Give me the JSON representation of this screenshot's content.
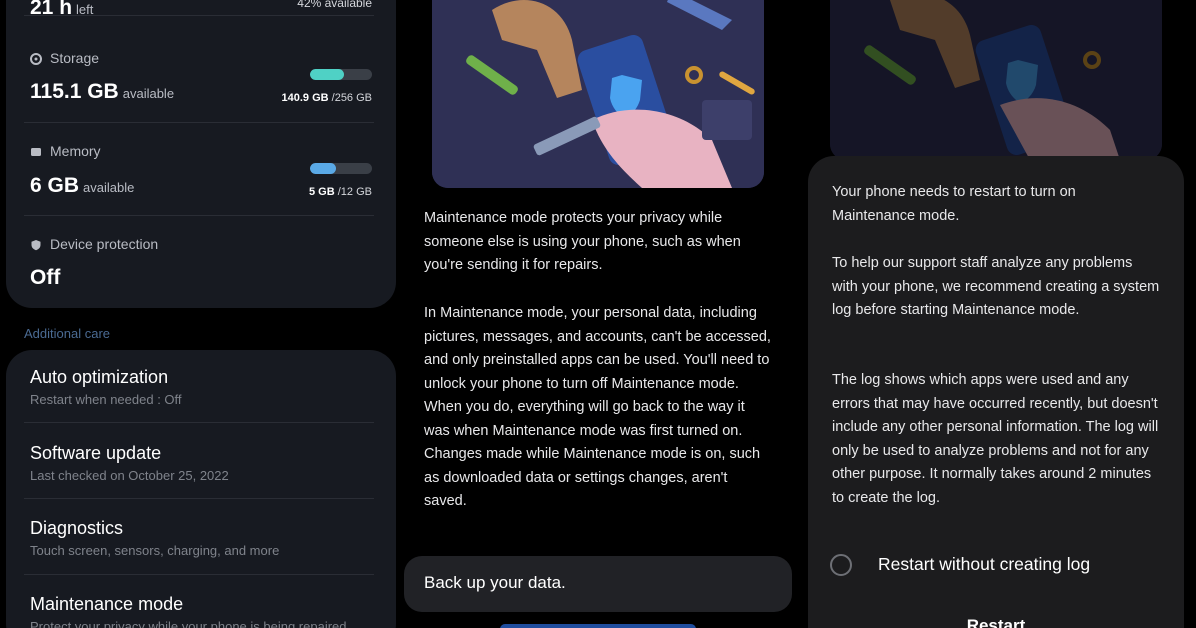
{
  "device_care": {
    "top_partial": {
      "value": "21 h",
      "unit": "left",
      "right": "42% available"
    },
    "storage": {
      "label": "Storage",
      "value": "115.1 GB",
      "unit": "available",
      "used": "140.9 GB",
      "total": "/256 GB",
      "fill_fraction": 0.55,
      "fill_color": "#4fd1c5"
    },
    "memory": {
      "label": "Memory",
      "value": "6 GB",
      "unit": "available",
      "used": "5 GB",
      "total": "/12 GB",
      "fill_fraction": 0.42,
      "fill_color": "#5aa9e6"
    },
    "protection": {
      "label": "Device protection",
      "value": "Off"
    },
    "additional_care": "Additional care",
    "menu": [
      {
        "title": "Auto optimization",
        "subtitle": "Restart when needed : Off"
      },
      {
        "title": "Software update",
        "subtitle": "Last checked on October 25, 2022"
      },
      {
        "title": "Diagnostics",
        "subtitle": "Touch screen, sensors, charging, and more"
      },
      {
        "title": "Maintenance mode",
        "subtitle": "Protect your privacy while your phone is being repaired"
      }
    ]
  },
  "maintenance_info": {
    "paragraph1": "Maintenance mode protects your privacy while someone else is using your phone, such as when you're sending it for repairs.",
    "paragraph2": "In Maintenance mode, your personal data, including pictures, messages, and accounts, can't be accessed, and only preinstalled apps can be used. You'll need to unlock your phone to turn off Maintenance mode. When you do, everything will go back to the way it was when Maintenance mode was first turned on. Changes made while Maintenance mode is on, such as downloaded data or settings changes, aren't saved.",
    "backup": "Back up your data."
  },
  "dialog": {
    "paragraph1": "Your phone needs to restart to turn on Maintenance mode.",
    "paragraph2": "To help our support staff analyze any problems with your phone, we recommend creating a system log before starting Maintenance mode.",
    "paragraph3": "The log shows which apps were used and any errors that may have occurred recently, but doesn't include any other personal information. The log will only be used to analyze problems and not for any other purpose. It normally takes around 2 minutes to create the log.",
    "option": "Restart without creating log",
    "button": "Restart"
  },
  "colors": {
    "card": "#171a21",
    "accent_storage": "#4fd1c5",
    "accent_memory": "#5aa9e6",
    "dialog": "#1c1c1e"
  }
}
